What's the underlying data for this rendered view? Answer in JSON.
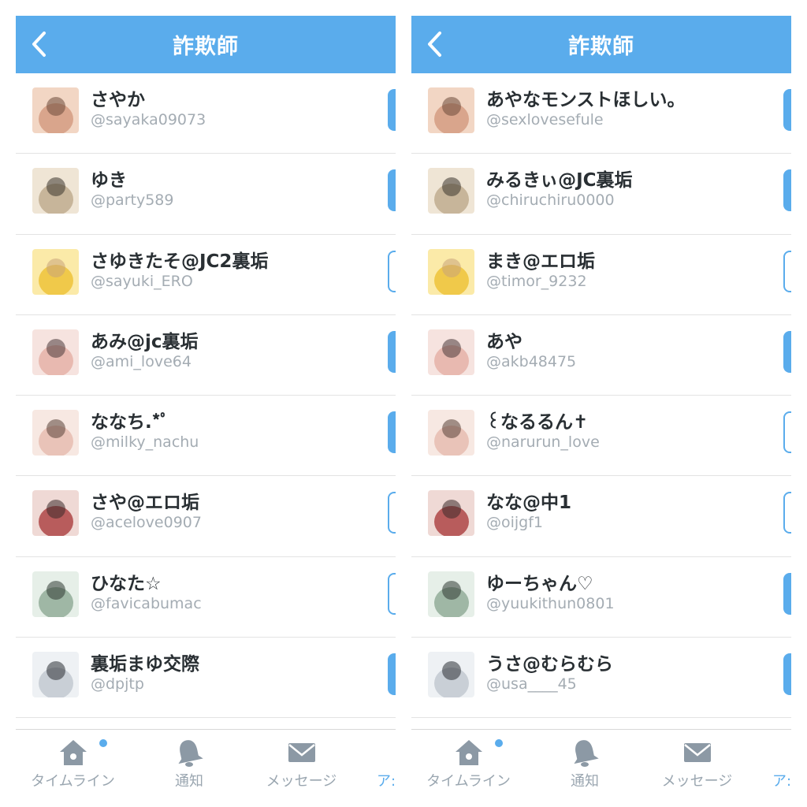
{
  "header": {
    "title": "詐欺師"
  },
  "left": {
    "users": [
      {
        "name": "さやか",
        "handle": "@sayaka09073",
        "following": true
      },
      {
        "name": "ゆき",
        "handle": "@party589",
        "following": true
      },
      {
        "name": "さゆきたそ@JC2裏垢",
        "handle": "@sayuki_ERO",
        "following": false
      },
      {
        "name": "あみ@jc裏垢",
        "handle": "@ami_love64",
        "following": true
      },
      {
        "name": "ななち.*ﾟ",
        "handle": "@milky_nachu",
        "following": true
      },
      {
        "name": "さや@エロ垢",
        "handle": "@acelove0907",
        "following": false
      },
      {
        "name": "ひなた☆",
        "handle": "@favicabumac",
        "following": false
      },
      {
        "name": "裏垢まゆ交際",
        "handle": "@dpjtp",
        "following": true
      }
    ]
  },
  "right": {
    "users": [
      {
        "name": "あやなモンストほしい。",
        "handle": "@sexlovesefule",
        "following": true
      },
      {
        "name": "みるきぃ@JC裏垢",
        "handle": "@chiruchiru0000",
        "following": true
      },
      {
        "name": "まき@エロ垢",
        "handle": "@timor_9232",
        "following": false
      },
      {
        "name": "あや",
        "handle": "@akb48475",
        "following": true
      },
      {
        "name": "꒰なるるん✝",
        "handle": "@narurun_love",
        "following": false
      },
      {
        "name": "なな@中1",
        "handle": "@oijgf1",
        "following": false
      },
      {
        "name": "ゆーちゃん♡",
        "handle": "@yuukithun0801",
        "following": true
      },
      {
        "name": "うさ@むらむら",
        "handle": "@usa____45",
        "following": true
      }
    ]
  },
  "tabs": {
    "home": "タイムライン",
    "notifications": "通知",
    "messages": "メッセージ",
    "more": "ア:"
  },
  "colors": {
    "accent": "#5aacec",
    "name_text": "#292f33",
    "handle_text": "#a4acb3",
    "tab_text": "#9aa6b0"
  },
  "icons": {
    "back": "chevron-left-icon",
    "home": "home-icon",
    "notifications": "bell-icon",
    "messages": "envelope-icon"
  }
}
